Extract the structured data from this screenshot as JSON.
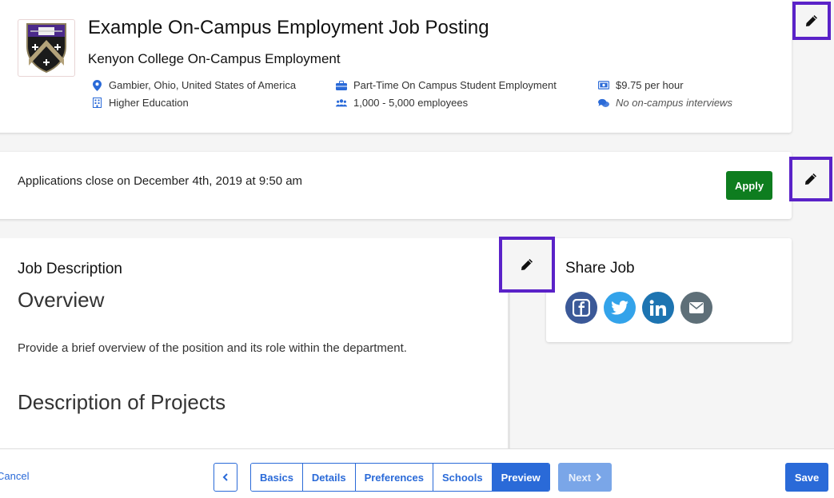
{
  "header": {
    "job_title": "Example On-Campus Employment Job Posting",
    "employer": "Kenyon College On-Campus Employment",
    "meta": {
      "location": "Gambier, Ohio, United States of America",
      "industry": "Higher Education",
      "job_type": "Part-Time On Campus Student Employment",
      "company_size": "1,000 - 5,000 employees",
      "pay": "$9.75 per hour",
      "interviews": "No on-campus interviews"
    },
    "icon_color": "#2a6ad8"
  },
  "application": {
    "close_text": "Applications close on December 4th, 2019 at 9:50 am",
    "apply_label": "Apply"
  },
  "description": {
    "section_label": "Job Description",
    "overview_heading": "Overview",
    "overview_text": "Provide a brief overview of the position and its role within the department.",
    "projects_heading": "Description of Projects"
  },
  "share": {
    "title": "Share Job",
    "networks": [
      {
        "name": "facebook",
        "color": "#3b5998"
      },
      {
        "name": "twitter",
        "color": "#33a3ea"
      },
      {
        "name": "linkedin",
        "color": "#1d74b1"
      },
      {
        "name": "email",
        "color": "#5e6f78"
      }
    ]
  },
  "footer": {
    "cancel_label": "Cancel",
    "steps": [
      "Basics",
      "Details",
      "Preferences",
      "Schools",
      "Preview"
    ],
    "active_step": "Preview",
    "next_label": "Next",
    "save_label": "Save"
  },
  "annotations": {
    "highlight_color": "#5a22c8"
  }
}
